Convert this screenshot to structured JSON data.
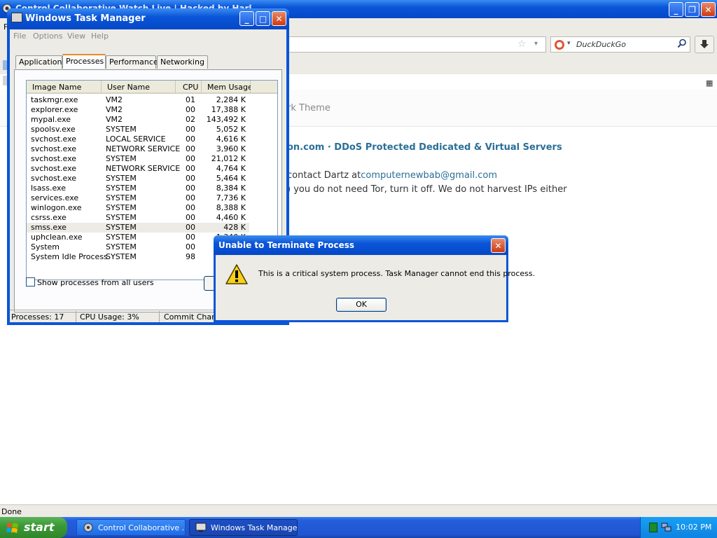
{
  "browser": {
    "title": "Control Collaborative Watch Live | Hacked by Harl",
    "search_placeholder": "DuckDuckGo",
    "page": {
      "theme_text": "rk Theme",
      "headline": "on.com · DDoS Protected Dedicated & Virtual Servers",
      "contact_prefix": "contact Dartz at",
      "contact_email": "computernewbab@gmail.com",
      "tor_line": ") you do not need Tor, turn it off. We do not harvest IPs either"
    },
    "status": "Done"
  },
  "task_manager": {
    "title": "Windows Task Manager",
    "menu": [
      "File",
      "Options",
      "View",
      "Help"
    ],
    "tabs": [
      "Applications",
      "Processes",
      "Performance",
      "Networking"
    ],
    "active_tab": "Processes",
    "columns": [
      "Image Name",
      "User Name",
      "CPU",
      "Mem Usage"
    ],
    "processes": [
      {
        "image": "taskmgr.exe",
        "user": "VM2",
        "cpu": "01",
        "mem": "2,284 K"
      },
      {
        "image": "explorer.exe",
        "user": "VM2",
        "cpu": "00",
        "mem": "17,388 K"
      },
      {
        "image": "mypal.exe",
        "user": "VM2",
        "cpu": "02",
        "mem": "143,492 K"
      },
      {
        "image": "spoolsv.exe",
        "user": "SYSTEM",
        "cpu": "00",
        "mem": "5,052 K"
      },
      {
        "image": "svchost.exe",
        "user": "LOCAL SERVICE",
        "cpu": "00",
        "mem": "4,616 K"
      },
      {
        "image": "svchost.exe",
        "user": "NETWORK SERVICE",
        "cpu": "00",
        "mem": "3,960 K"
      },
      {
        "image": "svchost.exe",
        "user": "SYSTEM",
        "cpu": "00",
        "mem": "21,012 K"
      },
      {
        "image": "svchost.exe",
        "user": "NETWORK SERVICE",
        "cpu": "00",
        "mem": "4,764 K"
      },
      {
        "image": "svchost.exe",
        "user": "SYSTEM",
        "cpu": "00",
        "mem": "5,464 K"
      },
      {
        "image": "lsass.exe",
        "user": "SYSTEM",
        "cpu": "00",
        "mem": "8,384 K"
      },
      {
        "image": "services.exe",
        "user": "SYSTEM",
        "cpu": "00",
        "mem": "7,736 K"
      },
      {
        "image": "winlogon.exe",
        "user": "SYSTEM",
        "cpu": "00",
        "mem": "8,388 K"
      },
      {
        "image": "csrss.exe",
        "user": "SYSTEM",
        "cpu": "00",
        "mem": "4,460 K"
      },
      {
        "image": "smss.exe",
        "user": "SYSTEM",
        "cpu": "00",
        "mem": "428 K",
        "selected": true
      },
      {
        "image": "uphclean.exe",
        "user": "SYSTEM",
        "cpu": "00",
        "mem": "1,340 K"
      },
      {
        "image": "System",
        "user": "SYSTEM",
        "cpu": "00",
        "mem": ""
      },
      {
        "image": "System Idle Process",
        "user": "SYSTEM",
        "cpu": "98",
        "mem": ""
      }
    ],
    "show_all_label": "Show processes from all users",
    "show_all_checked": false,
    "status": {
      "processes": "Processes: 17",
      "cpu": "CPU Usage: 3%",
      "commit": "Commit Charge"
    }
  },
  "dialog": {
    "title": "Unable to Terminate Process",
    "message": "This is a critical system process.  Task Manager cannot end this process.",
    "ok_label": "OK",
    "icon": "warning-icon"
  },
  "taskbar": {
    "start_label": "start",
    "tasks": [
      {
        "label": "Control Collaborative ...",
        "active": false
      },
      {
        "label": "Windows Task Manager",
        "active": true
      }
    ],
    "clock": "10:02 PM"
  },
  "colors": {
    "xp_blue": "#0a55d8",
    "start_green": "#3c9a37",
    "link": "#2a6f97"
  }
}
